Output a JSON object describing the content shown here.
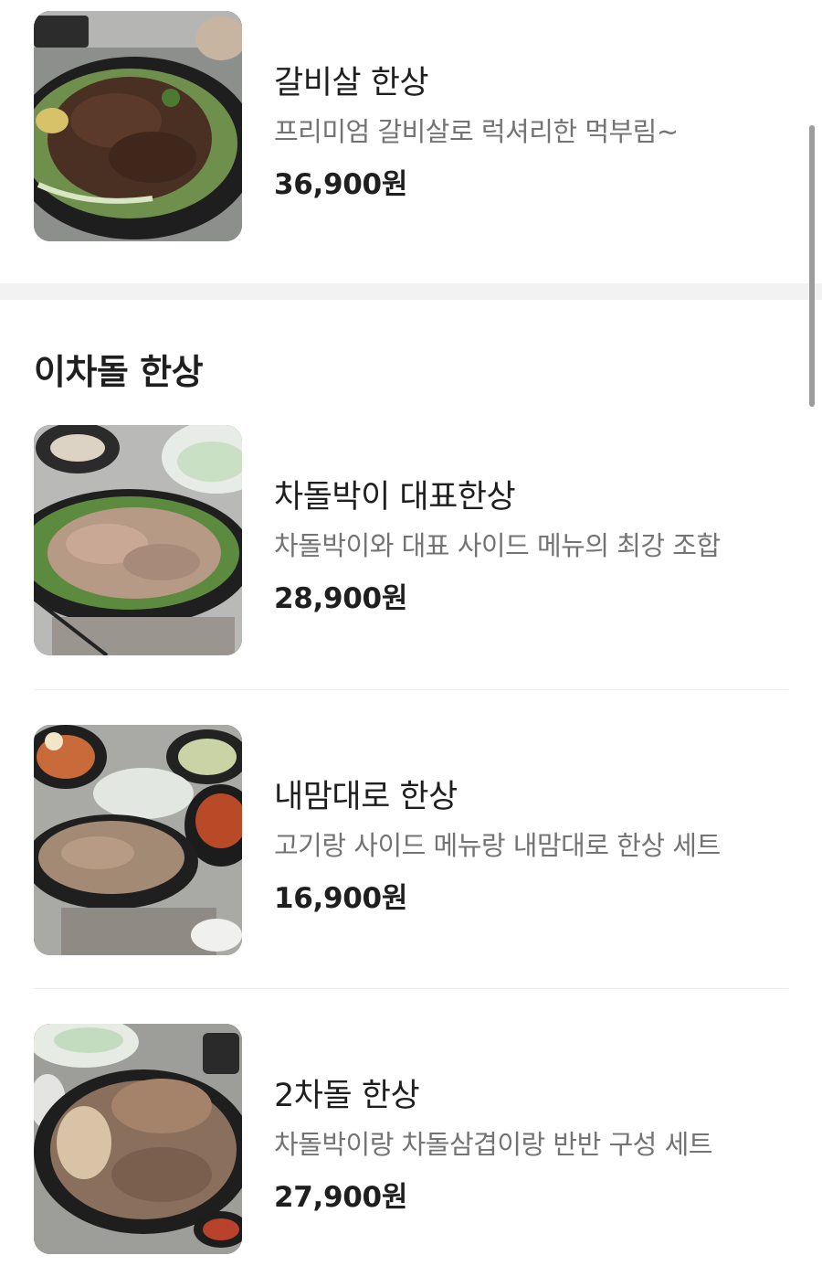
{
  "top_item": {
    "name": "갈비살 한상",
    "description": "프리미엄 갈비살로 럭셔리한 먹부림~",
    "price": "36,900원",
    "image": "grilled-galbi-platter-photo"
  },
  "section": {
    "title": "이차돌 한상",
    "items": [
      {
        "name": "차돌박이 대표한상",
        "description": "차돌박이와 대표 사이드 메뉴의 최강 조합",
        "price": "28,900원",
        "image": "chadolbagi-signature-set-photo"
      },
      {
        "name": "내맘대로 한상",
        "description": "고기랑 사이드 메뉴랑 내맘대로 한상 세트",
        "price": "16,900원",
        "image": "custom-set-photo"
      },
      {
        "name": "2차돌 한상",
        "description": "차돌박이랑 차돌삼겹이랑 반반 구성 세트",
        "price": "27,900원",
        "image": "two-chadol-half-half-photo"
      }
    ]
  },
  "colors": {
    "text": "#1f1f1f",
    "muted": "#737373",
    "band": "#f2f2f2",
    "divider": "#ececec",
    "scrollbar": "#9c9c9c"
  }
}
